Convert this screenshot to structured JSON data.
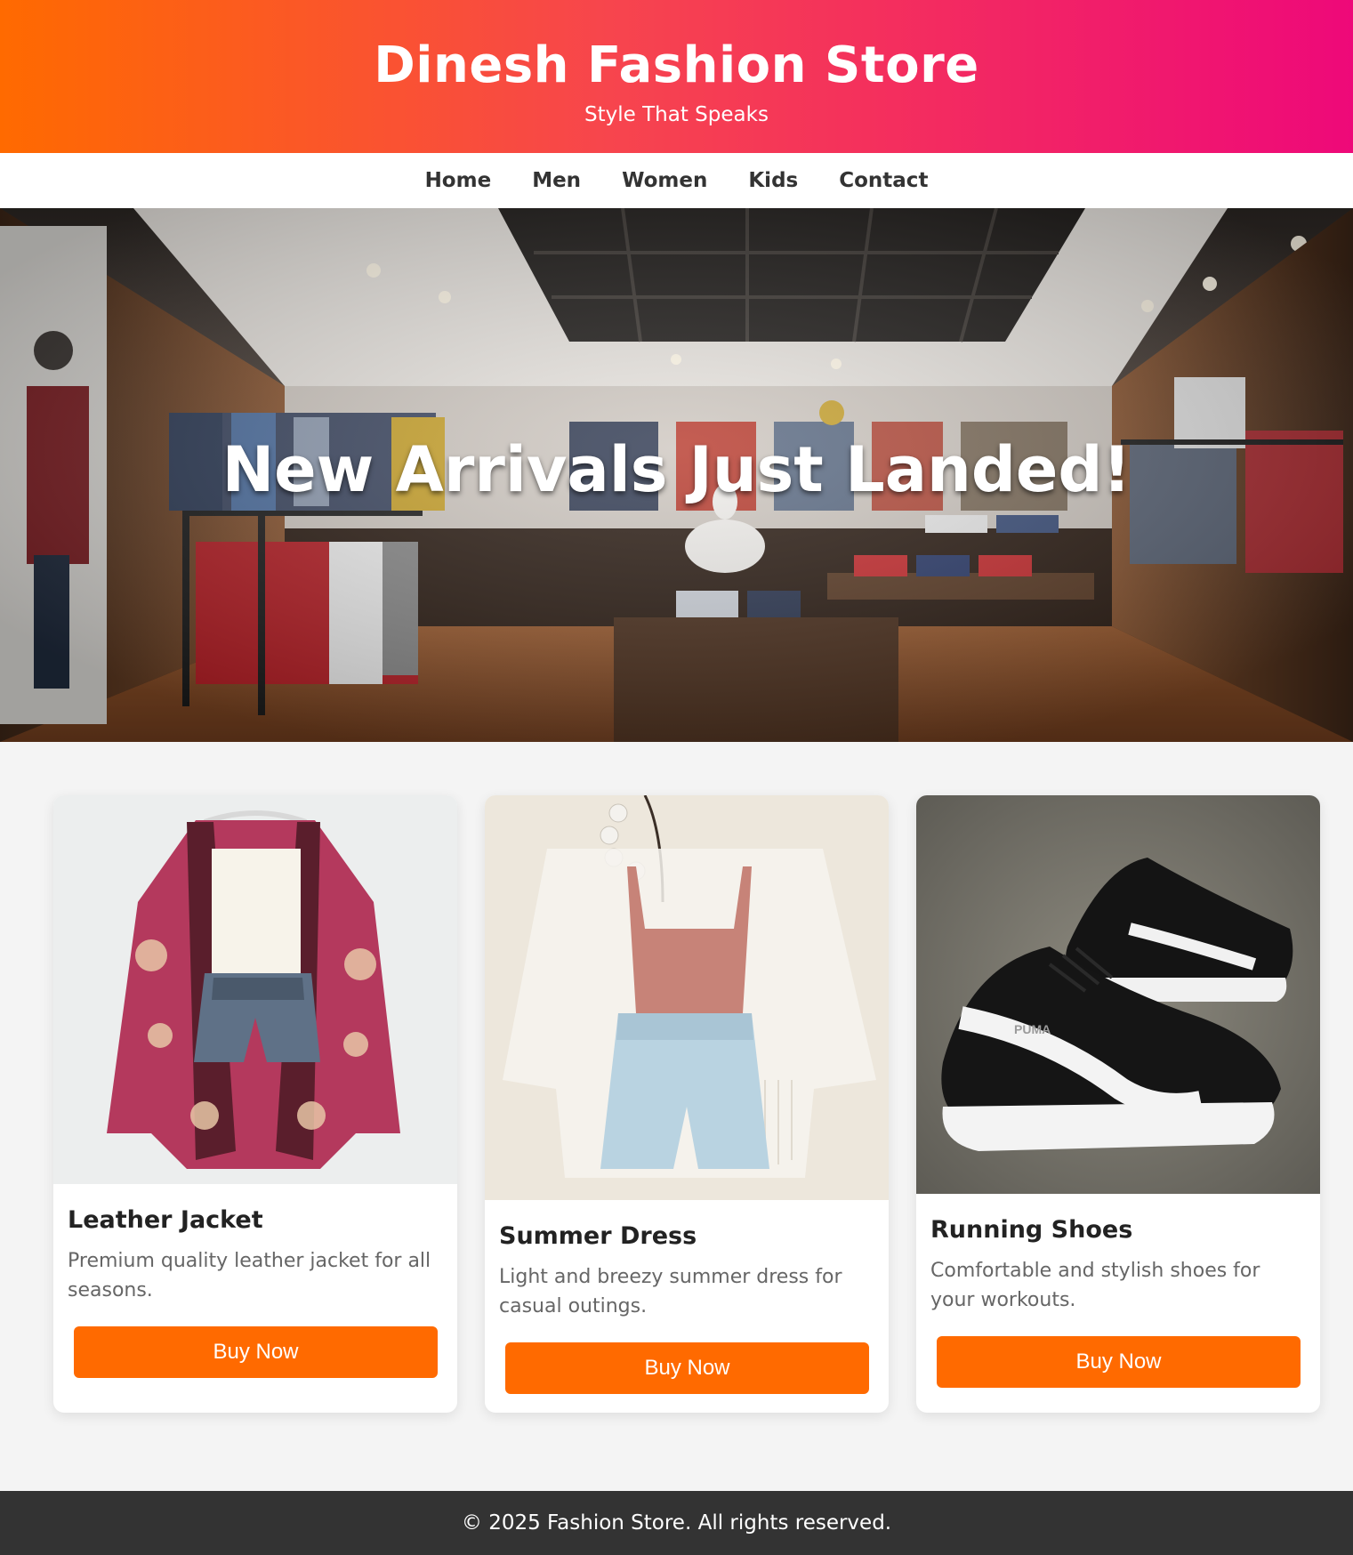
{
  "header": {
    "title": "Dinesh Fashion Store",
    "tagline": "Style That Speaks"
  },
  "nav": {
    "items": [
      "Home",
      "Men",
      "Women",
      "Kids",
      "Contact"
    ]
  },
  "hero": {
    "heading": "New Arrivals Just Landed!"
  },
  "products": [
    {
      "name": "Leather Jacket",
      "description": "Premium quality leather jacket for all seasons.",
      "button_label": "Buy Now"
    },
    {
      "name": "Summer Dress",
      "description": "Light and breezy summer dress for casual outings.",
      "button_label": "Buy Now"
    },
    {
      "name": "Running Shoes",
      "description": "Comfortable and stylish shoes for your workouts.",
      "button_label": "Buy Now"
    }
  ],
  "footer": {
    "text": "© 2025 Fashion Store. All rights reserved."
  },
  "colors": {
    "header_gradient_start": "#ff6a00",
    "header_gradient_end": "#ee0979",
    "button": "#ff6a00",
    "footer_bg": "#333333",
    "page_bg": "#f4f4f4"
  }
}
